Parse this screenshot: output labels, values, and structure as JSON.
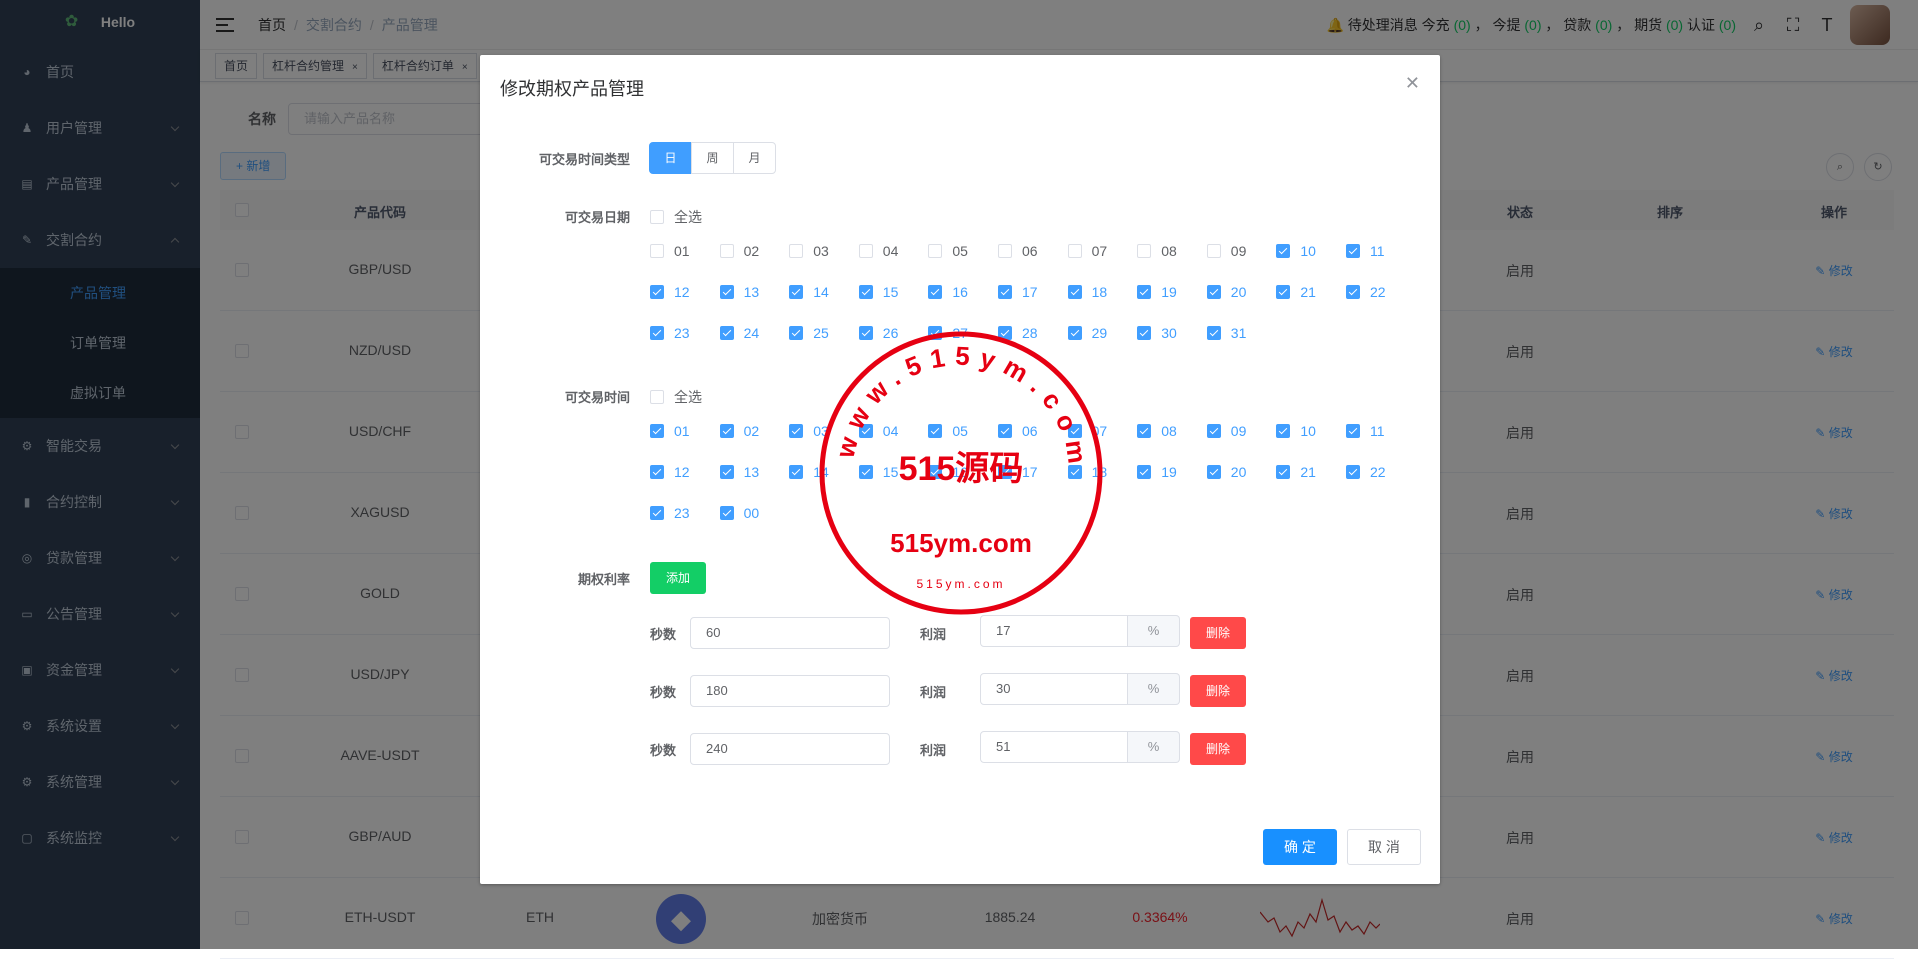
{
  "sidebar": {
    "logo_text": "Hello",
    "items": [
      {
        "label": "首页",
        "icon": "dashboard-icon"
      },
      {
        "label": "用户管理",
        "icon": "user-icon"
      },
      {
        "label": "产品管理",
        "icon": "document-icon"
      },
      {
        "label": "交割合约",
        "icon": "edit-icon"
      },
      {
        "label": "智能交易",
        "icon": "gear-icon"
      },
      {
        "label": "合约控制",
        "icon": "bar-chart-icon"
      },
      {
        "label": "贷款管理",
        "icon": "money-icon"
      },
      {
        "label": "公告管理",
        "icon": "message-icon"
      },
      {
        "label": "资金管理",
        "icon": "wallet-icon"
      },
      {
        "label": "系统设置",
        "icon": "gear-icon"
      },
      {
        "label": "系统管理",
        "icon": "gear-icon"
      },
      {
        "label": "系统监控",
        "icon": "monitor-icon"
      }
    ],
    "sub_items": [
      "产品管理",
      "订单管理",
      "虚拟订单"
    ]
  },
  "navbar": {
    "breadcrumb": [
      "首页",
      "交割合约",
      "产品管理"
    ],
    "notice_text": "待处理消息 今充",
    "counts": [
      {
        "label": "今提",
        "value": "(0)"
      },
      {
        "label": "贷款",
        "value": "(0)"
      },
      {
        "label": "期货",
        "value": "(0)"
      },
      {
        "label": "认证",
        "value": "(0)"
      }
    ],
    "first_count": "(0)",
    "comma": "，"
  },
  "tags": [
    {
      "label": "首页",
      "closable": false
    },
    {
      "label": "杠杆合约管理",
      "closable": true
    },
    {
      "label": "杠杆合约订单",
      "closable": true
    }
  ],
  "filter": {
    "label": "名称",
    "placeholder": "请输入产品名称"
  },
  "add_button": "+ 新增",
  "table": {
    "headers": [
      "产品代码",
      "状态",
      "排序",
      "操作"
    ],
    "rows": [
      {
        "code": "GBP/USD",
        "status": "启用"
      },
      {
        "code": "NZD/USD",
        "status": "启用"
      },
      {
        "code": "USD/CHF",
        "status": "启用"
      },
      {
        "code": "XAGUSD",
        "status": "启用"
      },
      {
        "code": "GOLD",
        "status": "启用"
      },
      {
        "code": "USD/JPY",
        "status": "启用"
      },
      {
        "code": "AAVE-USDT",
        "status": "启用"
      },
      {
        "code": "GBP/AUD",
        "status": "启用"
      },
      {
        "code": "ETH-USDT",
        "status": "启用",
        "symbol": "ETH",
        "category": "加密货币",
        "price": "1885.24",
        "change": "0.3364%"
      }
    ],
    "edit_label": "修改"
  },
  "dialog": {
    "title": "修改期权产品管理",
    "time_type_label": "可交易时间类型",
    "time_types": [
      "日",
      "周",
      "月"
    ],
    "selected_time_type": "日",
    "dates_label": "可交易日期",
    "select_all": "全选",
    "dates": [
      "01",
      "02",
      "03",
      "04",
      "05",
      "06",
      "07",
      "08",
      "09",
      "10",
      "11",
      "12",
      "13",
      "14",
      "15",
      "16",
      "17",
      "18",
      "19",
      "20",
      "21",
      "22",
      "23",
      "24",
      "25",
      "26",
      "27",
      "28",
      "29",
      "30",
      "31"
    ],
    "dates_checked": [
      false,
      false,
      false,
      false,
      false,
      false,
      false,
      false,
      false,
      true,
      true,
      true,
      true,
      true,
      true,
      true,
      true,
      true,
      true,
      true,
      true,
      true,
      true,
      true,
      true,
      true,
      true,
      true,
      true,
      true,
      true
    ],
    "hours_label": "可交易时间",
    "hours": [
      "01",
      "02",
      "03",
      "04",
      "05",
      "06",
      "07",
      "08",
      "09",
      "10",
      "11",
      "12",
      "13",
      "14",
      "15",
      "16",
      "17",
      "18",
      "19",
      "20",
      "21",
      "22",
      "23",
      "00"
    ],
    "rate_label": "期权利率",
    "add_label": "添加",
    "seconds_label": "秒数",
    "profit_label": "利润",
    "unit": "%",
    "delete_label": "删除",
    "rates": [
      {
        "seconds": "60",
        "profit": "17"
      },
      {
        "seconds": "180",
        "profit": "30"
      },
      {
        "seconds": "240",
        "profit": "51"
      }
    ],
    "confirm": "确 定",
    "cancel": "取 消"
  },
  "watermark": {
    "center": "515源码",
    "domain": "515ym.com",
    "ring": "www.515ym.com",
    "small": "515ym.com",
    "color": "#e60012"
  }
}
